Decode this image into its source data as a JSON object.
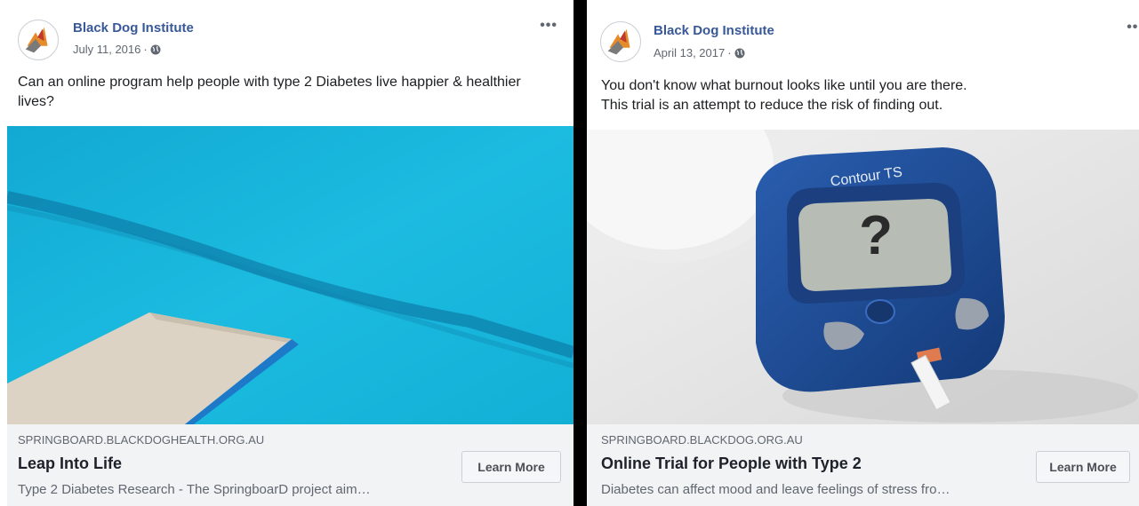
{
  "posts": [
    {
      "page_name": "Black Dog Institute",
      "date": "July 11, 2016",
      "separator": "·",
      "caption": "Can an online program help people with type 2 Diabetes live happier & healthier lives?",
      "link": {
        "domain": "SPRINGBOARD.BLACKDOGHEALTH.ORG.AU",
        "headline": "Leap Into Life",
        "description": "Type 2 Diabetes Research - The SpringboarD project aim…",
        "button_label": "Learn More"
      }
    },
    {
      "page_name": "Black Dog Institute",
      "date": "April 13, 2017",
      "separator": "·",
      "caption_lines": [
        "You don't know what burnout looks like until you are there.",
        "This trial is an attempt to reduce the risk of finding out."
      ],
      "device_label": "Contour TS",
      "screen_symbol": "?",
      "link": {
        "domain": "SPRINGBOARD.BLACKDOG.ORG.AU",
        "headline": "Online Trial for People with Type 2",
        "description": "Diabetes can affect mood and leave feelings of stress fro…",
        "button_label": "Learn More"
      }
    }
  ],
  "more_icon": "more-horizontal-icon",
  "privacy_icon": "globe-icon",
  "colors": {
    "page_name": "#385898",
    "pool": "#15b3d8",
    "meter": "#1d4a94"
  }
}
